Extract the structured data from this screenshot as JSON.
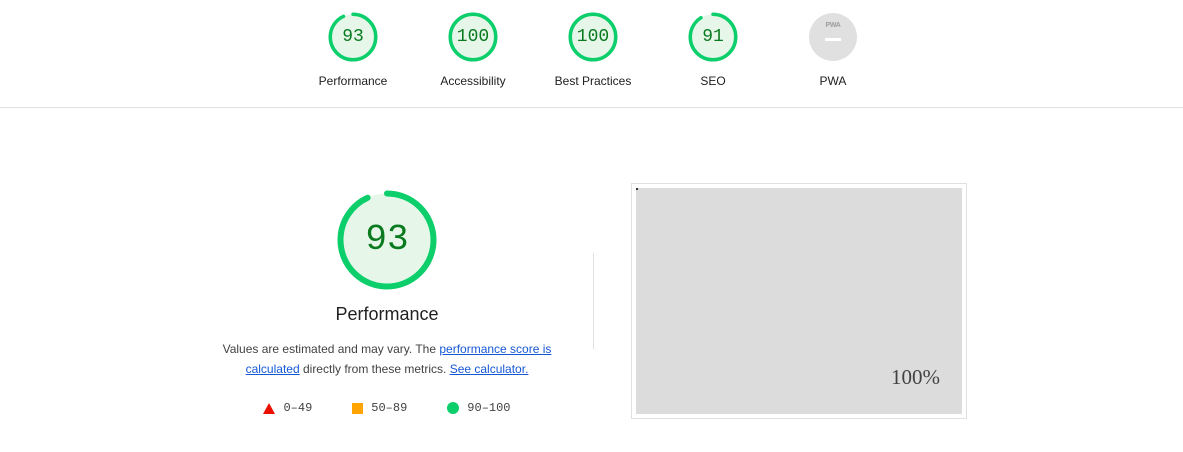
{
  "colors": {
    "pass": "#0cce6b",
    "pass_text": "#0a7a1f",
    "pass_fill": "#e6f7ea",
    "average": "#ffa400",
    "fail": "#eb0f00",
    "link": "#1558d6",
    "na": "#e0e0e0"
  },
  "gauges": [
    {
      "label": "Performance",
      "score": "93",
      "fraction": 0.93
    },
    {
      "label": "Accessibility",
      "score": "100",
      "fraction": 1.0
    },
    {
      "label": "Best Practices",
      "score": "100",
      "fraction": 1.0
    },
    {
      "label": "SEO",
      "score": "91",
      "fraction": 0.91
    },
    {
      "label": "PWA",
      "badge_text": "PWA",
      "icon": "pwa-badge-icon"
    }
  ],
  "performance": {
    "score": "93",
    "fraction": 0.93,
    "title": "Performance",
    "desc_prefix": "Values are estimated and may vary. The ",
    "desc_link": "performance score is calculated",
    "desc_middle": " directly from these metrics. ",
    "desc_link2": "See calculator.",
    "legend": [
      {
        "range": "0–49",
        "icon": "fail-triangle-icon"
      },
      {
        "range": "50–89",
        "icon": "average-square-icon"
      },
      {
        "range": "90–100",
        "icon": "pass-circle-icon"
      }
    ]
  },
  "screenshot": {
    "zoom_label": "100%"
  }
}
